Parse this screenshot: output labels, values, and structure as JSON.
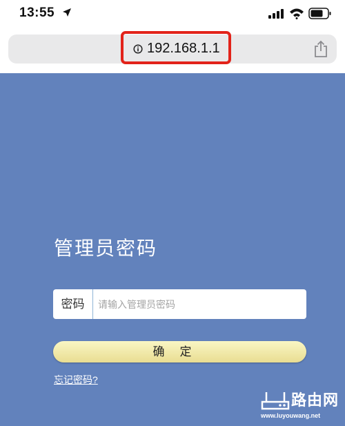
{
  "status_bar": {
    "time": "13:55"
  },
  "browser": {
    "url": "192.168.1.1"
  },
  "login": {
    "title": "管理员密码",
    "password_label": "密码",
    "password_placeholder": "请输入管理员密码",
    "password_value": "",
    "confirm_label": "确定",
    "forgot_link": "忘记密码?"
  },
  "watermark": {
    "brand_cn": "路由网",
    "domain": "www.luyouwang.net"
  },
  "colors": {
    "page_background": "#6282bc",
    "highlight": "#e2231a",
    "button": "#f3eeb0"
  }
}
